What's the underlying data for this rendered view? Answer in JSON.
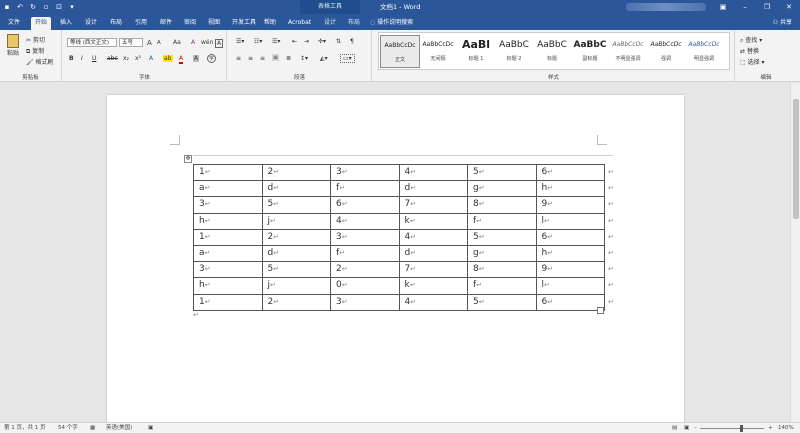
{
  "titlebar": {
    "context_tab": "表格工具",
    "doc_title": "文档1 - Word"
  },
  "tabs": [
    "文件",
    "开始",
    "插入",
    "设计",
    "布局",
    "引用",
    "邮件",
    "审阅",
    "视图",
    "开发工具",
    "帮助",
    "Acrobat",
    "设计",
    "布局"
  ],
  "tell_me": "操作说明搜索",
  "share": "共享",
  "ribbon": {
    "clipboard": {
      "paste": "粘贴",
      "cut": "剪切",
      "copy": "复制",
      "format_painter": "格式刷",
      "label": "剪贴板"
    },
    "font": {
      "font_name": "等线 (西文正文)",
      "font_size": "五号",
      "grow": "A",
      "shrink": "A",
      "case": "Aa",
      "clear": "A",
      "phonetic": "wén",
      "border": "A",
      "bold": "B",
      "italic": "I",
      "underline": "U",
      "strike": "abc",
      "sub": "x₂",
      "sup": "x²",
      "effects": "A",
      "highlight": "ab",
      "color": "A",
      "shade": "A",
      "enclose": "字",
      "label": "字体"
    },
    "paragraph": {
      "label": "段落"
    },
    "styles": {
      "items": [
        {
          "preview": "AaBbCcDc",
          "name": "正文"
        },
        {
          "preview": "AaBbCcDc",
          "name": "无间隔"
        },
        {
          "preview": "AaBl",
          "name": "标题 1"
        },
        {
          "preview": "AaBbC",
          "name": "标题 2"
        },
        {
          "preview": "AaBbC",
          "name": "标题"
        },
        {
          "preview": "AaBbC",
          "name": "副标题"
        },
        {
          "preview": "AaBbCcDc",
          "name": "不明显强调"
        },
        {
          "preview": "AaBbCcDc",
          "name": "强调"
        },
        {
          "preview": "AaBbCcDc",
          "name": "明显强调"
        }
      ],
      "label": "样式"
    },
    "editing": {
      "find": "查找",
      "replace": "替换",
      "select": "选择",
      "label": "编辑"
    }
  },
  "table": {
    "rows": [
      [
        "1",
        "2",
        "3",
        "4",
        "5",
        "6"
      ],
      [
        "a",
        "d",
        "f",
        "d",
        "g",
        "h"
      ],
      [
        "3",
        "5",
        "6",
        "7",
        "8",
        "9"
      ],
      [
        "h",
        "j",
        "4",
        "k",
        "f",
        "l"
      ],
      [
        "1",
        "2",
        "3",
        "4",
        "5",
        "6"
      ],
      [
        "a",
        "d",
        "f",
        "d",
        "g",
        "h"
      ],
      [
        "3",
        "5",
        "2",
        "7",
        "8",
        "9"
      ],
      [
        "h",
        "j",
        "0",
        "k",
        "f",
        "l"
      ],
      [
        "1",
        "2",
        "3",
        "4",
        "5",
        "6"
      ]
    ],
    "cell_mark": "↵",
    "row_mark": "↵"
  },
  "statusbar": {
    "page": "第 1 页，共 1 页",
    "words": "54 个字",
    "language": "英语(美国)",
    "zoom": "140%"
  },
  "colors": {
    "accent": "#2b579a"
  }
}
